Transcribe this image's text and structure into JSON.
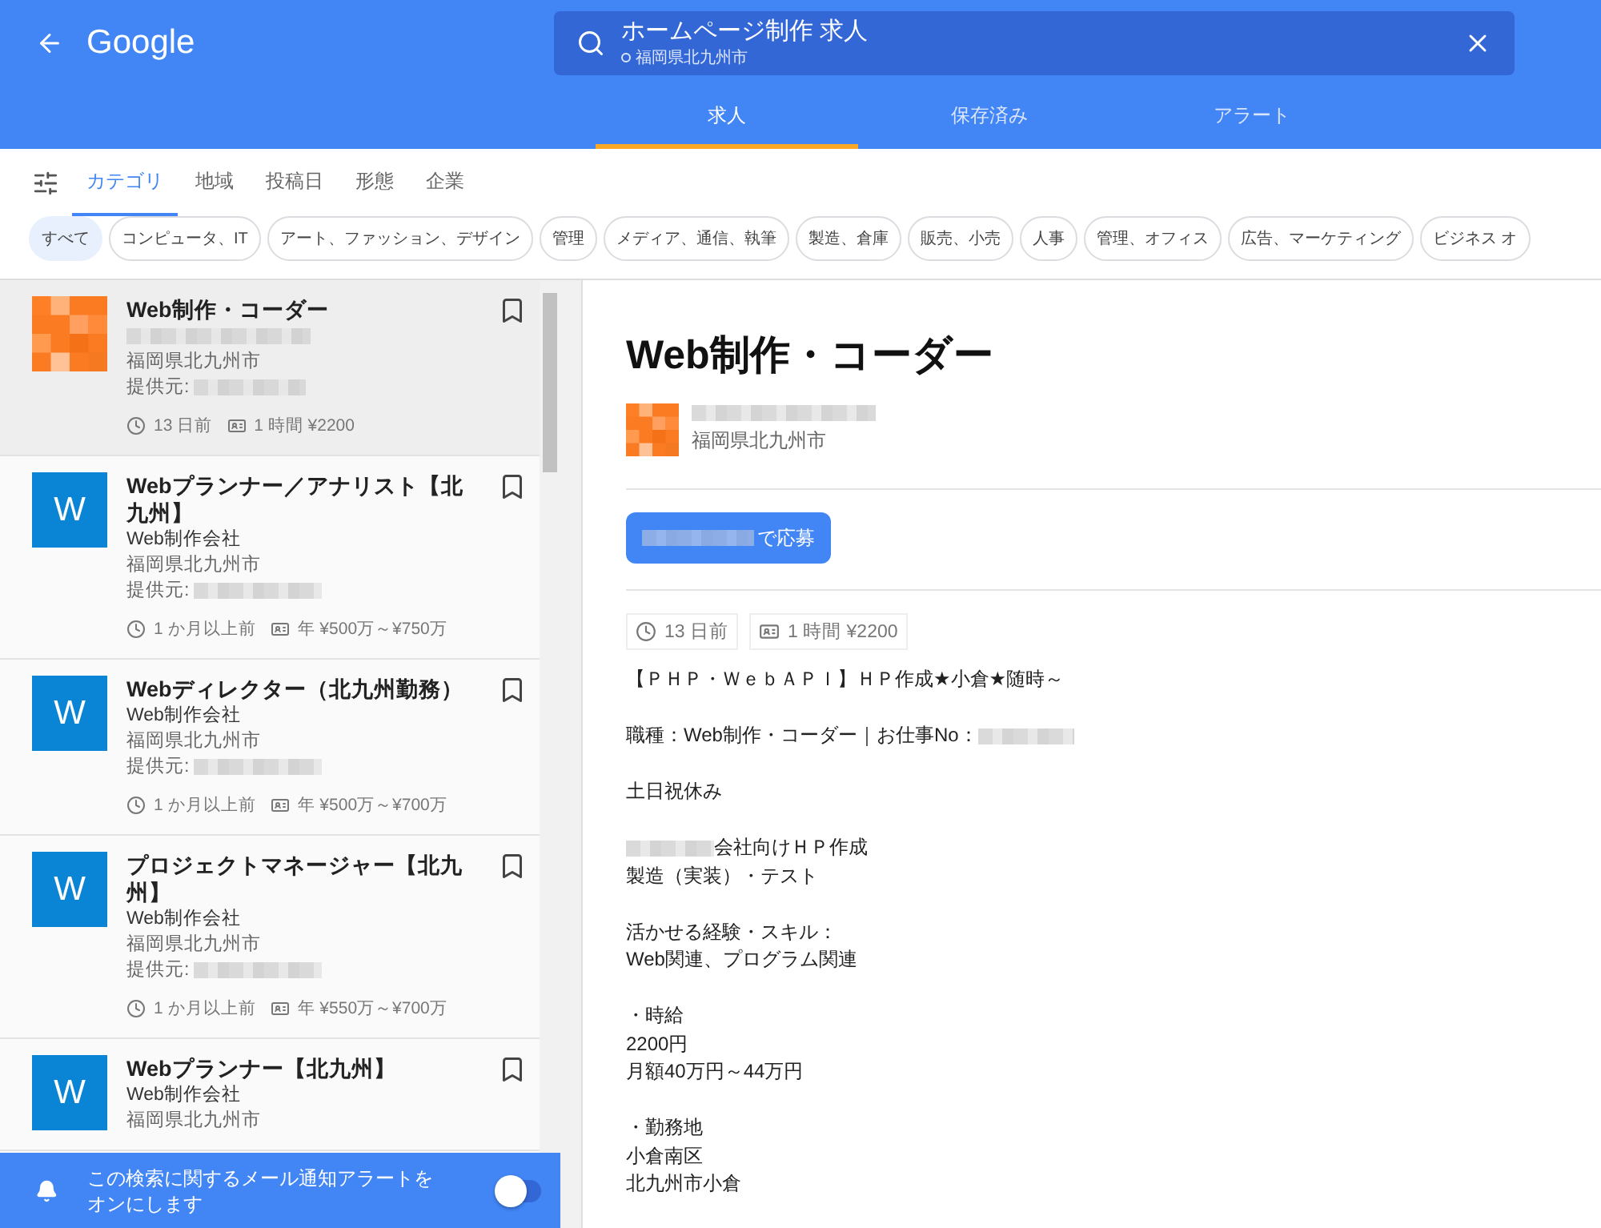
{
  "header": {
    "logo": "Google",
    "search": {
      "query": "ホームページ制作 求人",
      "location": "福岡県北九州市"
    },
    "tabs": [
      {
        "label": "求人",
        "selected": true
      },
      {
        "label": "保存済み",
        "selected": false
      },
      {
        "label": "アラート",
        "selected": false
      }
    ]
  },
  "filter_tabs": [
    {
      "label": "カテゴリ",
      "selected": true
    },
    {
      "label": "地域",
      "selected": false
    },
    {
      "label": "投稿日",
      "selected": false
    },
    {
      "label": "形態",
      "selected": false
    },
    {
      "label": "企業",
      "selected": false
    }
  ],
  "chips": [
    {
      "label": "すべて",
      "selected": true
    },
    {
      "label": "コンピュータ、IT",
      "selected": false
    },
    {
      "label": "アート、ファッション、デザイン",
      "selected": false
    },
    {
      "label": "管理",
      "selected": false
    },
    {
      "label": "メディア、通信、執筆",
      "selected": false
    },
    {
      "label": "製造、倉庫",
      "selected": false
    },
    {
      "label": "販売、小売",
      "selected": false
    },
    {
      "label": "人事",
      "selected": false
    },
    {
      "label": "管理、オフィス",
      "selected": false
    },
    {
      "label": "広告、マーケティング",
      "selected": false
    },
    {
      "label": "ビジネス オ",
      "selected": false
    }
  ],
  "jobs": [
    {
      "title": "Web制作・コーダー",
      "kind": "picture",
      "location": "福岡県北九州市",
      "provider": "提供元:",
      "age": "13 日前",
      "pay": "1 時間 ¥2200",
      "selected": true,
      "saved": false
    },
    {
      "title": "Webプランナー／アナリスト【北九州】",
      "kind": "letter",
      "logo": "W",
      "company": "Web制作会社",
      "location": "福岡県北九州市",
      "provider": "提供元:",
      "age": "1 か月以上前",
      "pay": "年 ¥500万～¥750万",
      "selected": false,
      "saved": false
    },
    {
      "title": "Webディレクター（北九州勤務）",
      "kind": "letter",
      "logo": "W",
      "company": "Web制作会社",
      "location": "福岡県北九州市",
      "provider": "提供元:",
      "age": "1 か月以上前",
      "pay": "年 ¥500万～¥700万",
      "selected": false,
      "saved": false
    },
    {
      "title": "プロジェクトマネージャー【北九州】",
      "kind": "letter",
      "logo": "W",
      "company": "Web制作会社",
      "location": "福岡県北九州市",
      "provider": "提供元:",
      "age": "1 か月以上前",
      "pay": "年 ¥550万～¥700万",
      "selected": false,
      "saved": false
    },
    {
      "title": "Webプランナー【北九州】",
      "kind": "letter",
      "logo": "W",
      "company": "Web制作会社",
      "location": "福岡県北九州市",
      "selected": false,
      "saved": false
    }
  ],
  "alert": {
    "text": "この検索に関するメール通知アラートをオンにします",
    "on": false
  },
  "detail": {
    "title": "Web制作・コーダー",
    "location": "福岡県北九州市",
    "apply": "で応募",
    "age": "13 日前",
    "pay": "1 時間 ¥2200",
    "description": [
      [
        {
          "text": "【ＰＨＰ・ＷｅｂＡＰＩ】ＨＰ作成★小倉★随時～"
        }
      ],
      [
        {
          "text": "職種：Web制作・コーダー｜お仕事No：",
          "redacted_end": true
        }
      ],
      [
        {
          "text": "土日祝休み"
        }
      ],
      [
        {
          "text": "会社向けＨＰ作成",
          "redacted_start": true
        },
        {
          "text": "製造（実装）・テスト"
        }
      ],
      [
        {
          "text": "活かせる経験・スキル："
        },
        {
          "text": "Web関連、プログラム関連"
        }
      ],
      [
        {
          "text": "・時給"
        },
        {
          "text": "2200円"
        },
        {
          "text": "月額40万円～44万円"
        }
      ],
      [
        {
          "text": "・勤務地"
        },
        {
          "text": "小倉南区"
        },
        {
          "text": "北九州市小倉"
        }
      ]
    ]
  }
}
